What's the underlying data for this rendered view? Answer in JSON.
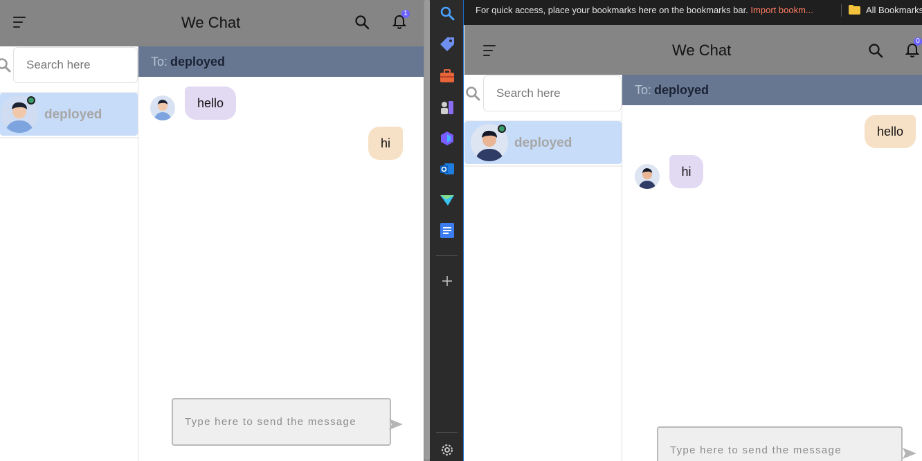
{
  "left_window": {
    "app_title": "We Chat",
    "notification_count": "1",
    "search_placeholder": "Search here",
    "contact_name": "deployed",
    "to_label": "To:",
    "to_name": "deployed",
    "messages": [
      {
        "direction": "incoming",
        "text": "hello"
      },
      {
        "direction": "outgoing",
        "text": "hi"
      }
    ],
    "composer_placeholder": "Type here to send the message"
  },
  "right_window": {
    "bookmarks_bar": {
      "prompt": "For quick access, place your bookmarks here on the bookmarks bar.",
      "import_link": "Import bookm...",
      "all_bookmarks": "All Bookmarks"
    },
    "app_title": "We Chat",
    "notification_count": "0",
    "search_placeholder": "Search here",
    "contact_name": "deployed",
    "to_label": "To:",
    "to_name": "deployed",
    "messages": [
      {
        "direction": "outgoing",
        "text": "hello"
      },
      {
        "direction": "incoming",
        "text": "hi"
      }
    ],
    "composer_placeholder": "Type here to send the message"
  },
  "edge_sidebar": {
    "items": [
      "search-icon",
      "tag-icon",
      "briefcase-icon",
      "chess-icon",
      "copilot-icon",
      "outlook-icon",
      "send-icon",
      "docs-icon",
      "add-icon",
      "settings-icon"
    ]
  },
  "colors": {
    "appbar": "#858585",
    "to_bar": "#677791",
    "selected_contact": "#c6dcf9",
    "incoming_bubble": "#e2d9f3",
    "outgoing_bubble": "#f7e1c6",
    "online_dot": "#3a9b6a",
    "badge": "#6c63ff",
    "import_link": "#ff7b63"
  }
}
